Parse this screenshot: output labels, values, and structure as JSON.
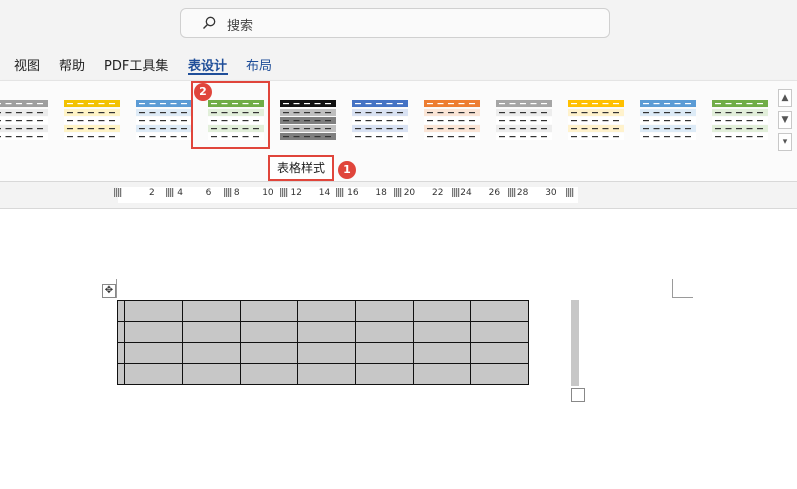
{
  "search": {
    "placeholder": "搜索",
    "icon": "search-icon"
  },
  "tabs": [
    {
      "label": "视图",
      "active": false
    },
    {
      "label": "帮助",
      "active": false
    },
    {
      "label": "PDF工具集",
      "active": false
    },
    {
      "label": "表设计",
      "active": true
    },
    {
      "label": "布局",
      "active": false,
      "color": "#1f4e99"
    }
  ],
  "ribbon": {
    "group_label": "表格样式",
    "styles": [
      {
        "name": "gray",
        "color": "#9e9e9e",
        "tint": "#ececec"
      },
      {
        "name": "gold",
        "color": "#f2c200",
        "tint": "#fff4c6"
      },
      {
        "name": "blue-light",
        "color": "#5b9bd5",
        "tint": "#deebf7"
      },
      {
        "name": "green",
        "color": "#70ad47",
        "tint": "#e2efda",
        "selected": true
      },
      {
        "name": "black",
        "color": "#111111",
        "tint": "#bfbfbf"
      },
      {
        "name": "blue",
        "color": "#4472c4",
        "tint": "#d9e2f3"
      },
      {
        "name": "orange",
        "color": "#ed7d31",
        "tint": "#fbe5d6"
      },
      {
        "name": "gray-2",
        "color": "#a5a5a5",
        "tint": "#ededed"
      },
      {
        "name": "gold-2",
        "color": "#ffc000",
        "tint": "#fff2cc"
      },
      {
        "name": "blue-2",
        "color": "#5b9bd5",
        "tint": "#ddebf7"
      },
      {
        "name": "green-2",
        "color": "#70ad47",
        "tint": "#e2efda"
      }
    ],
    "scroll": {
      "up": "▲",
      "down": "▼",
      "more": "▾"
    }
  },
  "annotations": [
    {
      "number": "1",
      "color": "#e0453b"
    },
    {
      "number": "2",
      "color": "#e0453b"
    }
  ],
  "ruler": {
    "ticks": [
      "2",
      "4",
      "6",
      "8",
      "10",
      "12",
      "14",
      "16",
      "18",
      "20",
      "22",
      "24",
      "26",
      "28",
      "30"
    ]
  },
  "document": {
    "table": {
      "rows": 4,
      "cols": 8,
      "fill": "#c7c7c7"
    },
    "move_handle": "✥"
  }
}
